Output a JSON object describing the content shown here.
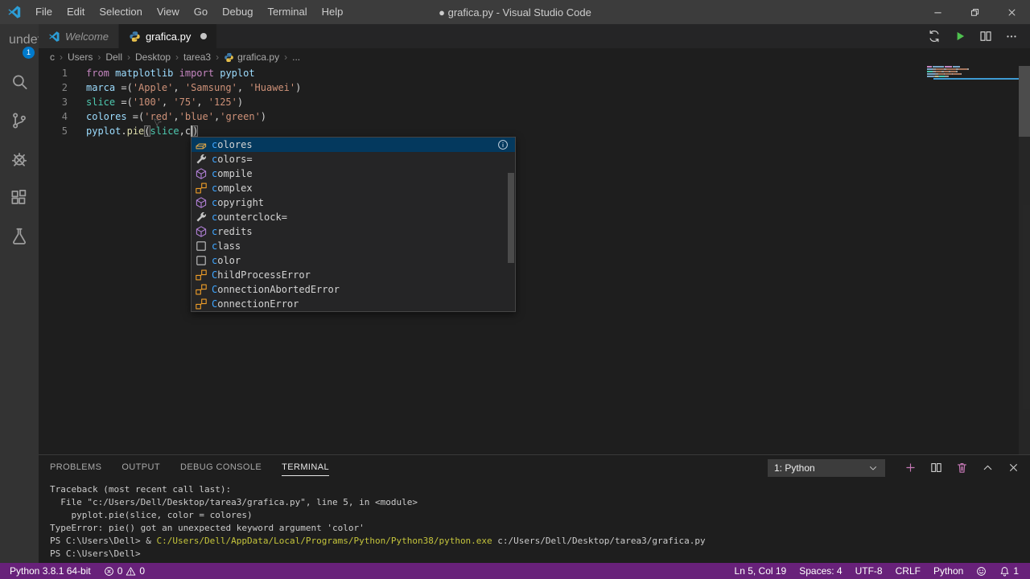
{
  "colors": {
    "accent": "#007ACC",
    "statusbar_bg": "#68217A",
    "suggest_selection_bg": "#04395E",
    "match_highlight": "#40A6FF",
    "terminal_command_yellow": "#C5C53C",
    "run_button_green": "#4FC14F",
    "panel_icon_pink": "#C678B6"
  },
  "titlebar": {
    "menus": [
      "File",
      "Edit",
      "Selection",
      "View",
      "Go",
      "Debug",
      "Terminal",
      "Help"
    ],
    "title": "● grafica.py - Visual Studio Code",
    "window_controls": [
      "minimize",
      "restore",
      "close"
    ]
  },
  "activity_bar": [
    {
      "id": "explorer",
      "badge": "1"
    },
    {
      "id": "search"
    },
    {
      "id": "source-control"
    },
    {
      "id": "run-and-debug"
    },
    {
      "id": "extensions"
    },
    {
      "id": "testing"
    }
  ],
  "tabs": [
    {
      "label": "Welcome",
      "icon": "vscode",
      "active": false,
      "dirty": false,
      "italic": true
    },
    {
      "label": "grafica.py",
      "icon": "python",
      "active": true,
      "dirty": true,
      "italic": false
    }
  ],
  "editor_actions": [
    {
      "id": "open-changes",
      "icon": "sync"
    },
    {
      "id": "run-python-file",
      "icon": "run"
    },
    {
      "id": "split-editor",
      "icon": "split"
    },
    {
      "id": "more-actions",
      "icon": "ellipsis"
    }
  ],
  "breadcrumb": [
    {
      "label": "c"
    },
    {
      "label": "Users"
    },
    {
      "label": "Dell"
    },
    {
      "label": "Desktop"
    },
    {
      "label": "tarea3"
    },
    {
      "label": "grafica.py",
      "icon": "python"
    },
    {
      "label": "..."
    }
  ],
  "editor": {
    "cursor_line": "5",
    "cursor_col": "19",
    "lines": [
      {
        "num": "1",
        "tokens": [
          [
            "from",
            "kw"
          ],
          [
            " ",
            "pl"
          ],
          [
            "matplotlib",
            "var"
          ],
          [
            " ",
            "pl"
          ],
          [
            "import",
            "kw"
          ],
          [
            " ",
            "pl"
          ],
          [
            "pyplot",
            "var"
          ]
        ]
      },
      {
        "num": "2",
        "tokens": [
          [
            "marca",
            "var"
          ],
          [
            " =(",
            "pl"
          ],
          [
            "'Apple'",
            "str"
          ],
          [
            ", ",
            "pl"
          ],
          [
            "'Samsung'",
            "str"
          ],
          [
            ", ",
            "pl"
          ],
          [
            "'Huawei'",
            "str"
          ],
          [
            ")",
            "pl"
          ]
        ]
      },
      {
        "num": "3",
        "tokens": [
          [
            "slice",
            "builtin"
          ],
          [
            " =(",
            "pl"
          ],
          [
            "'100'",
            "str"
          ],
          [
            ", ",
            "pl"
          ],
          [
            "'75'",
            "str"
          ],
          [
            ", ",
            "pl"
          ],
          [
            "'125'",
            "str"
          ],
          [
            ")",
            "pl"
          ]
        ]
      },
      {
        "num": "4",
        "tokens": [
          [
            "colores",
            "var"
          ],
          [
            " =(",
            "pl"
          ],
          [
            "'red'",
            "str"
          ],
          [
            ",",
            "pl"
          ],
          [
            "'blue'",
            "str"
          ],
          [
            ",",
            "pl"
          ],
          [
            "'green'",
            "str"
          ],
          [
            ")",
            "pl"
          ]
        ]
      },
      {
        "num": "5",
        "tokens": [
          [
            "pyplot",
            "var"
          ],
          [
            ".",
            "pl"
          ],
          [
            "pie",
            "fn"
          ],
          [
            "(",
            "bracket"
          ],
          [
            "slice",
            "builtin"
          ],
          [
            ",",
            "pl"
          ],
          [
            "c",
            "pl"
          ],
          [
            "",
            "cursor"
          ],
          [
            ")",
            "bracket"
          ]
        ]
      }
    ]
  },
  "suggest": {
    "items": [
      {
        "match": "c",
        "rest": "olores",
        "kind": "field",
        "selected": true,
        "info": true
      },
      {
        "match": "c",
        "rest": "olors=",
        "kind": "wrench",
        "selected": false,
        "info": false
      },
      {
        "match": "c",
        "rest": "ompile",
        "kind": "method",
        "selected": false,
        "info": false
      },
      {
        "match": "c",
        "rest": "omplex",
        "kind": "class",
        "selected": false,
        "info": false
      },
      {
        "match": "c",
        "rest": "opyright",
        "kind": "method",
        "selected": false,
        "info": false
      },
      {
        "match": "c",
        "rest": "ounterclock=",
        "kind": "wrench",
        "selected": false,
        "info": false
      },
      {
        "match": "c",
        "rest": "redits",
        "kind": "method",
        "selected": false,
        "info": false
      },
      {
        "match": "c",
        "rest": "lass",
        "kind": "keyword",
        "selected": false,
        "info": false
      },
      {
        "match": "c",
        "rest": "olor",
        "kind": "keyword",
        "selected": false,
        "info": false
      },
      {
        "match": "C",
        "rest": "hildProcessError",
        "kind": "class",
        "selected": false,
        "info": false
      },
      {
        "match": "C",
        "rest": "onnectionAbortedError",
        "kind": "class",
        "selected": false,
        "info": false
      },
      {
        "match": "C",
        "rest": "onnectionError",
        "kind": "class",
        "selected": false,
        "info": false
      }
    ]
  },
  "panel": {
    "tabs": [
      {
        "label": "PROBLEMS",
        "active": false
      },
      {
        "label": "OUTPUT",
        "active": false
      },
      {
        "label": "DEBUG CONSOLE",
        "active": false
      },
      {
        "label": "TERMINAL",
        "active": true
      }
    ],
    "terminal_picker": {
      "value": "1: Python"
    },
    "actions": [
      {
        "id": "new-terminal",
        "icon": "plus",
        "pink": true
      },
      {
        "id": "split-terminal",
        "icon": "split",
        "pink": false
      },
      {
        "id": "kill-terminal",
        "icon": "trash",
        "pink": true
      },
      {
        "id": "maximize-panel",
        "icon": "chevron-up",
        "pink": false
      },
      {
        "id": "close-panel",
        "icon": "close",
        "pink": false
      }
    ],
    "terminal_lines": [
      {
        "segments": [
          [
            "Traceback (most recent call last):",
            "default"
          ]
        ]
      },
      {
        "segments": [
          [
            "  File \"c:/Users/Dell/Desktop/tarea3/grafica.py\", line 5, in <module>",
            "default"
          ]
        ]
      },
      {
        "segments": [
          [
            "    pyplot.pie(slice, color = colores)",
            "default"
          ]
        ]
      },
      {
        "segments": [
          [
            "TypeError: pie() got an unexpected keyword argument 'color'",
            "default"
          ]
        ]
      },
      {
        "segments": [
          [
            "PS C:\\Users\\Dell> & ",
            "default"
          ],
          [
            "C:/Users/Dell/AppData/Local/Programs/Python/Python38/python.exe",
            "yellow"
          ],
          [
            " c:/Users/Dell/Desktop/tarea3/grafica.py",
            "default"
          ]
        ]
      },
      {
        "segments": [
          [
            "PS C:\\Users\\Dell>",
            "default"
          ]
        ]
      }
    ]
  },
  "status_bar": {
    "python_version": "Python 3.8.1 64-bit",
    "errors": "0",
    "warnings": "0",
    "right": [
      {
        "id": "cursor-position",
        "label": "Ln 5, Col 19"
      },
      {
        "id": "indentation",
        "label": "Spaces: 4"
      },
      {
        "id": "encoding",
        "label": "UTF-8"
      },
      {
        "id": "eol",
        "label": "CRLF"
      },
      {
        "id": "language-mode",
        "label": "Python"
      },
      {
        "id": "feedback",
        "icon": "smiley",
        "label": ""
      },
      {
        "id": "notifications",
        "icon": "bell",
        "label": "1"
      }
    ]
  }
}
